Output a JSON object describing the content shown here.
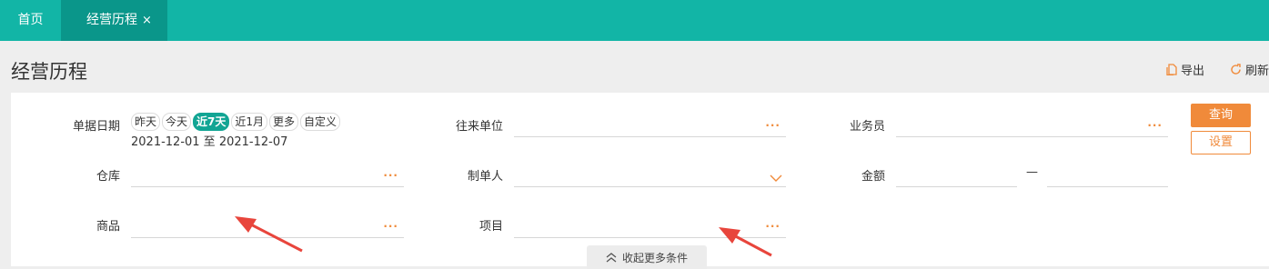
{
  "tabs": {
    "home": "首页",
    "active": "经营历程",
    "close": "×"
  },
  "page_title": "经营历程",
  "toolbar": {
    "export_label": "导出",
    "refresh_label": "刷新"
  },
  "filters": {
    "date_label": "单据日期",
    "date_options": [
      "昨天",
      "今天",
      "近7天",
      "近1月",
      "更多",
      "自定义"
    ],
    "date_selected": "近7天",
    "date_range": "2021-12-01 至 2021-12-07",
    "partner_label": "往来单位",
    "salesperson_label": "业务员",
    "warehouse_label": "仓库",
    "creator_label": "制单人",
    "amount_label": "金额",
    "amount_separator": "—",
    "goods_label": "商品",
    "project_label": "项目",
    "more_dots": "···"
  },
  "buttons": {
    "query": "查询",
    "settings": "设置"
  },
  "collapse_label": "收起更多条件",
  "colors": {
    "topbar": "#12b5a6",
    "active_tab": "#0a968a",
    "accent": "#f08a3a",
    "arrow": "#e8453c"
  }
}
